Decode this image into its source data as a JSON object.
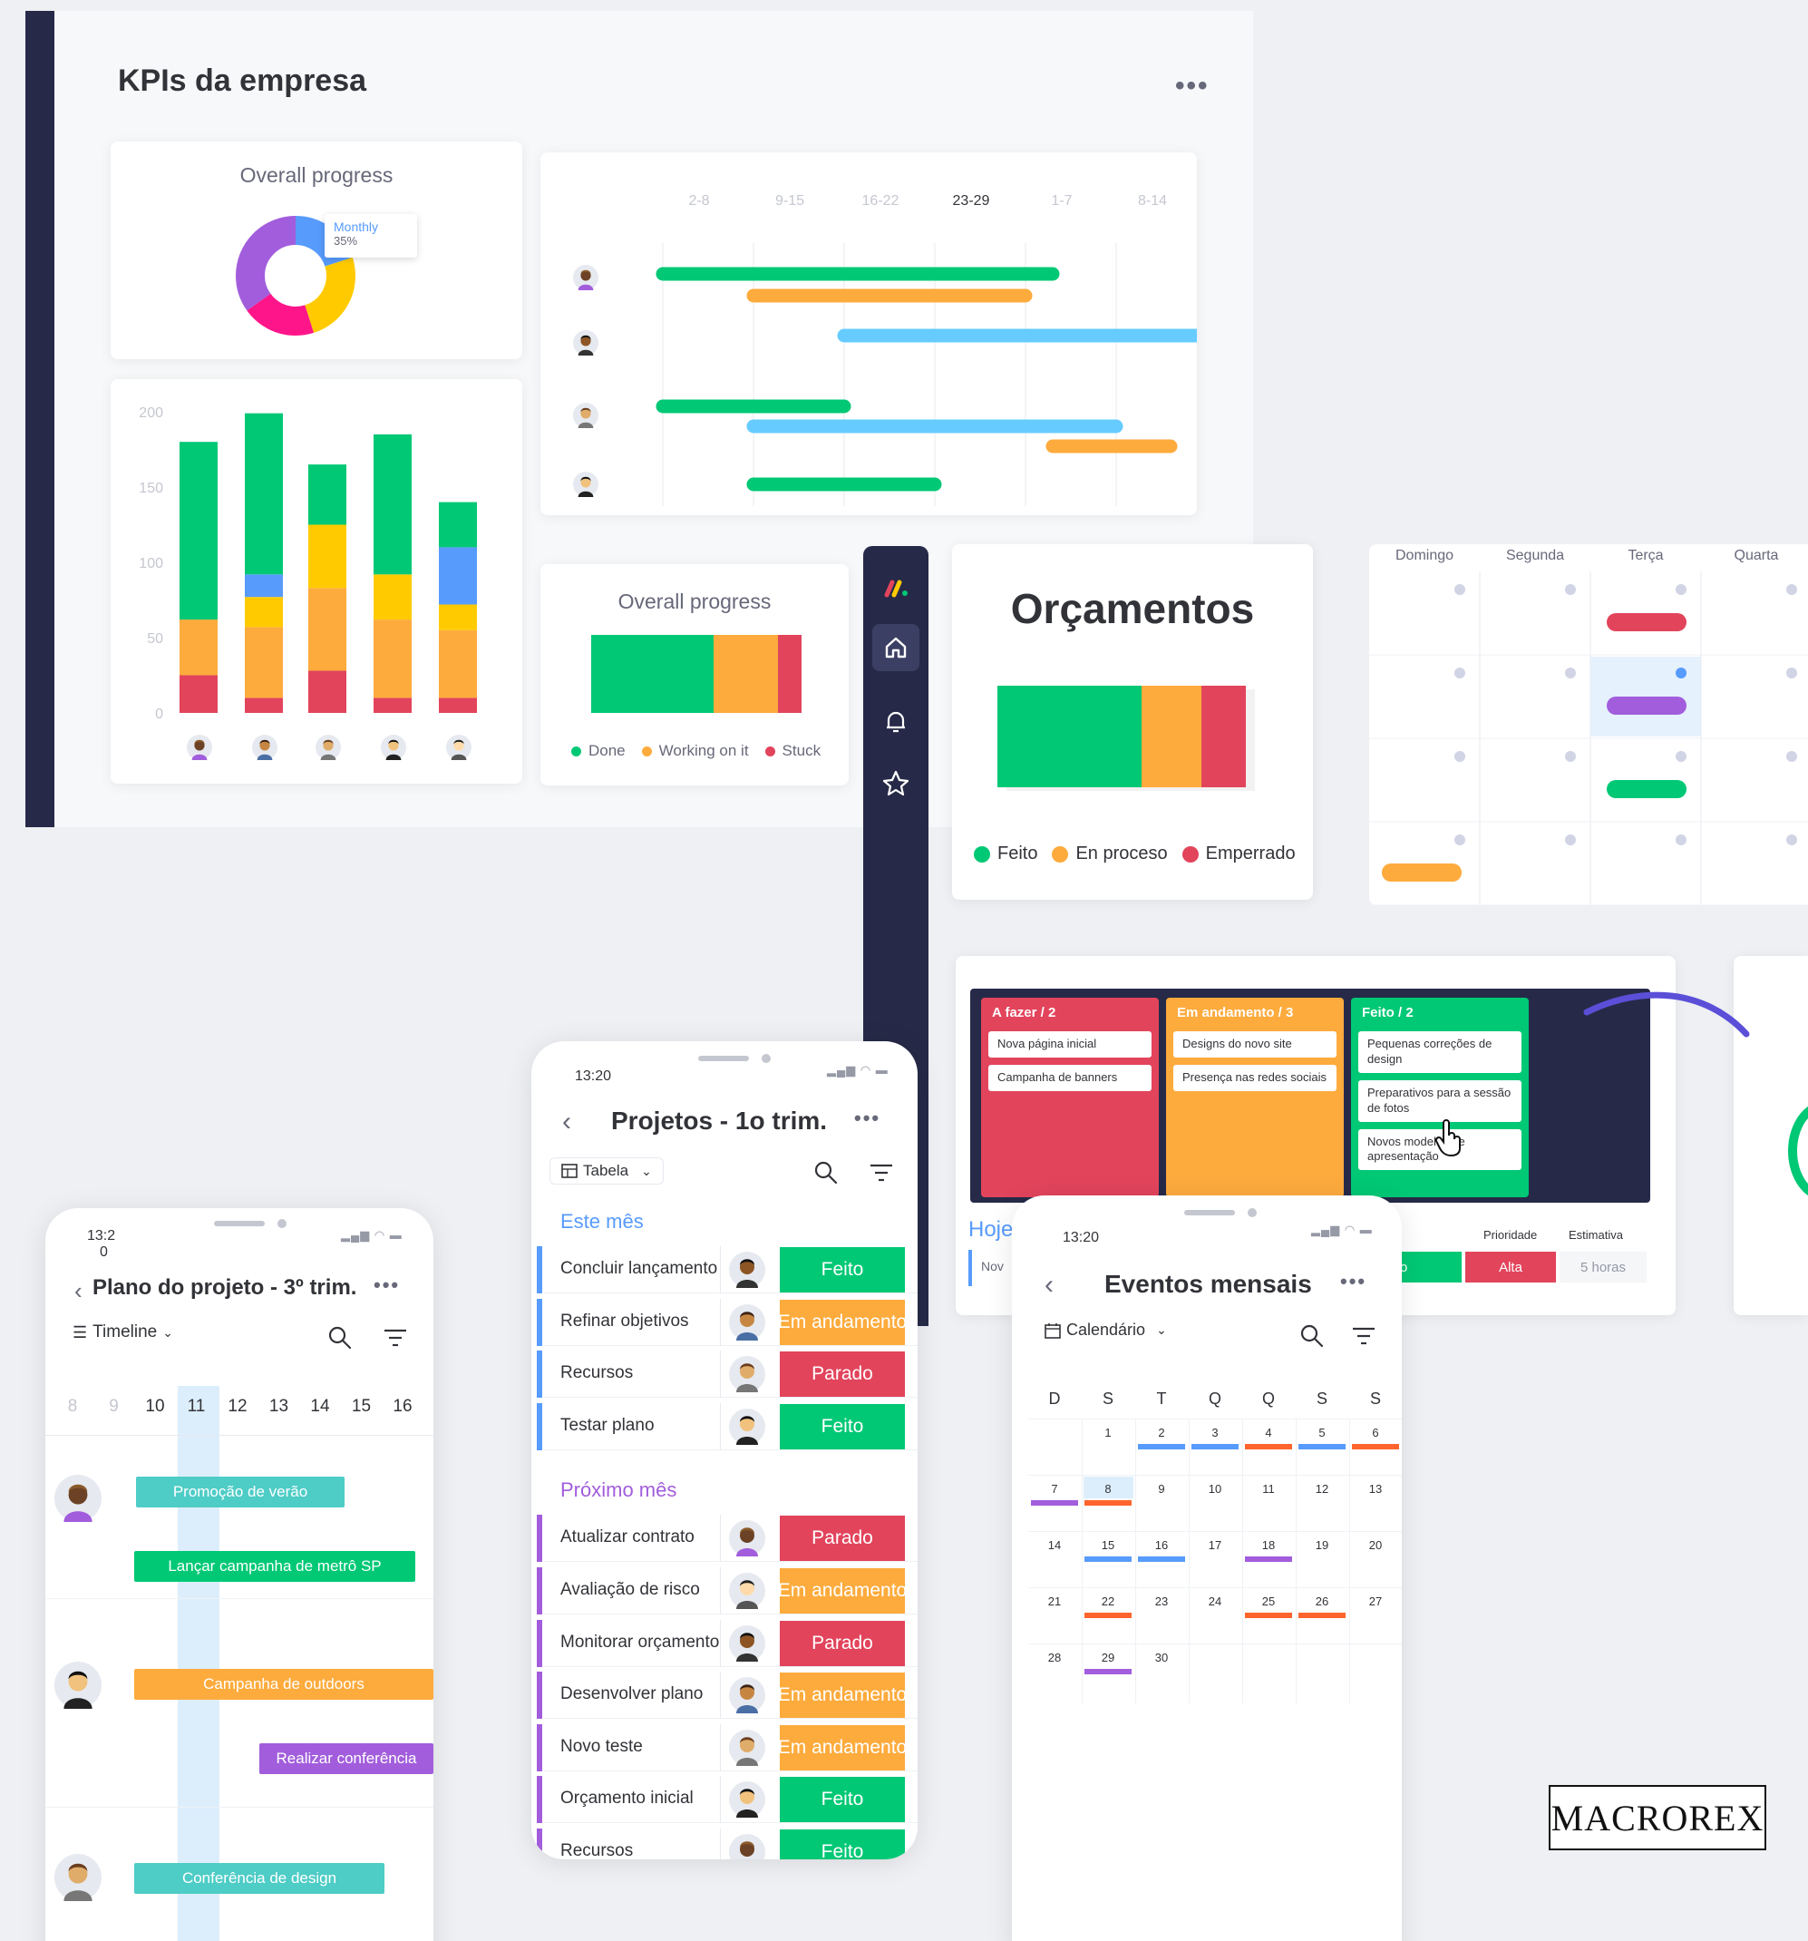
{
  "colors": {
    "done": "#00c875",
    "working": "#fdab3d",
    "stuck": "#e2445c",
    "blue": "#579bfc",
    "light_blue": "#66ccff",
    "purple": "#a25ddc",
    "teal": "#4eccc6",
    "yellow": "#ffcb00",
    "pink": "#ff158a",
    "navy": "#262a48"
  },
  "dashboard": {
    "title": "KPIs da empresa",
    "menu": "•••",
    "overall_progress_title": "Overall progress",
    "donut_tooltip": {
      "label": "Monthly",
      "value": "35%"
    },
    "donut_segments": [
      {
        "color": "#579bfc",
        "value": 20
      },
      {
        "color": "#ffcb00",
        "value": 25
      },
      {
        "color": "#ff158a",
        "value": 20
      },
      {
        "color": "#a25ddc",
        "value": 35
      }
    ],
    "bar_chart": {
      "y_ticks": [
        "200",
        "150",
        "100",
        "50",
        "0"
      ],
      "ylim": [
        0,
        200
      ],
      "columns": [
        [
          {
            "c": "#e2445c",
            "v": 25
          },
          {
            "c": "#fdab3d",
            "v": 37
          },
          {
            "c": "#00c875",
            "v": 118
          }
        ],
        [
          {
            "c": "#e2445c",
            "v": 10
          },
          {
            "c": "#fdab3d",
            "v": 47
          },
          {
            "c": "#ffcb00",
            "v": 20
          },
          {
            "c": "#579bfc",
            "v": 15
          },
          {
            "c": "#00c875",
            "v": 107
          }
        ],
        [
          {
            "c": "#e2445c",
            "v": 28
          },
          {
            "c": "#fdab3d",
            "v": 55
          },
          {
            "c": "#ffcb00",
            "v": 42
          },
          {
            "c": "#00c875",
            "v": 40
          }
        ],
        [
          {
            "c": "#e2445c",
            "v": 10
          },
          {
            "c": "#fdab3d",
            "v": 52
          },
          {
            "c": "#ffcb00",
            "v": 30
          },
          {
            "c": "#00c875",
            "v": 93
          }
        ],
        [
          {
            "c": "#e2445c",
            "v": 10
          },
          {
            "c": "#fdab3d",
            "v": 45
          },
          {
            "c": "#ffcb00",
            "v": 17
          },
          {
            "c": "#579bfc",
            "v": 38
          },
          {
            "c": "#00c875",
            "v": 30
          }
        ]
      ]
    },
    "gantt": {
      "weeks": [
        "2-8",
        "9-15",
        "16-22",
        "23-29",
        "1-7",
        "8-14"
      ],
      "active_week": "23-29",
      "rows": [
        [
          {
            "c": "#00c875",
            "start": 0,
            "end": 4.3
          },
          {
            "c": "#fdab3d",
            "start": 1.0,
            "end": 4.0
          }
        ],
        [
          {
            "c": "#66ccff",
            "start": 2.0,
            "end": 5.9
          }
        ],
        [
          {
            "c": "#00c875",
            "start": 0,
            "end": 2.0
          },
          {
            "c": "#66ccff",
            "start": 1.0,
            "end": 5.0
          },
          {
            "c": "#fdab3d",
            "start": 4.3,
            "end": 5.6
          }
        ],
        [
          {
            "c": "#00c875",
            "start": 1.0,
            "end": 3.0
          }
        ]
      ]
    },
    "progress_bar": {
      "title": "Overall progress",
      "parts": [
        {
          "c": "#00c875",
          "v": 58
        },
        {
          "c": "#fdab3d",
          "v": 31
        },
        {
          "c": "#e2445c",
          "v": 11
        }
      ],
      "legend": [
        {
          "label": "Done",
          "c": "#00c875"
        },
        {
          "label": "Working on it",
          "c": "#fdab3d"
        },
        {
          "label": "Stuck",
          "c": "#e2445c"
        }
      ]
    }
  },
  "budget": {
    "title": "Orçamentos",
    "parts": [
      {
        "c": "#00c875",
        "v": 58
      },
      {
        "c": "#fdab3d",
        "v": 24
      },
      {
        "c": "#e2445c",
        "v": 18
      }
    ],
    "legend": [
      {
        "label": "Feito",
        "c": "#00c875"
      },
      {
        "label": "En proceso",
        "c": "#fdab3d"
      },
      {
        "label": "Emperrado",
        "c": "#e2445c"
      }
    ]
  },
  "week_calendar": {
    "days": [
      "Domingo",
      "Segunda",
      "Terça",
      "Quarta"
    ]
  },
  "kanban": {
    "columns": [
      {
        "title": "A fazer / 2",
        "color": "#e2445c",
        "cards": [
          "Nova página inicial",
          "Campanha de banners"
        ]
      },
      {
        "title": "Em andamento / 3",
        "color": "#fdab3d",
        "cards": [
          "Designs do novo site",
          "Presença nas redes sociais"
        ]
      },
      {
        "title": "Feito / 2",
        "color": "#00c875",
        "cards": [
          "Pequenas correções de design",
          "Preparativos para a sessão de fotos",
          "Novos modelos de apresentação"
        ]
      }
    ],
    "today_label": "Hoje",
    "today_item": "Nov",
    "col_priority": "Prioridade",
    "col_estimate": "Estimativa",
    "priority_value": "Alta",
    "estimate_value": "5 horas",
    "status_value": "o"
  },
  "phone_projects": {
    "time": "13:20",
    "title": "Projetos - 1o trim.",
    "menu": "•••",
    "view": "Tabela",
    "groups": [
      {
        "title": "Este mês",
        "color": "#579bfc",
        "rows": [
          {
            "name": "Concluir lançamento",
            "status": "Feito",
            "c": "#00c875"
          },
          {
            "name": "Refinar objetivos",
            "status": "Em andamento",
            "c": "#fdab3d"
          },
          {
            "name": "Recursos",
            "status": "Parado",
            "c": "#e2445c"
          },
          {
            "name": "Testar plano",
            "status": "Feito",
            "c": "#00c875"
          }
        ]
      },
      {
        "title": "Próximo mês",
        "color": "#a25ddc",
        "rows": [
          {
            "name": "Atualizar contrato",
            "status": "Parado",
            "c": "#e2445c"
          },
          {
            "name": "Avaliação de risco",
            "status": "Em andamento",
            "c": "#fdab3d"
          },
          {
            "name": "Monitorar orçamento",
            "status": "Parado",
            "c": "#e2445c"
          },
          {
            "name": "Desenvolver plano",
            "status": "Em andamento",
            "c": "#fdab3d"
          },
          {
            "name": "Novo teste",
            "status": "Em andamento",
            "c": "#fdab3d"
          },
          {
            "name": "Orçamento inicial",
            "status": "Feito",
            "c": "#00c875"
          },
          {
            "name": "Recursos",
            "status": "Feito",
            "c": "#00c875"
          }
        ]
      }
    ]
  },
  "phone_timeline": {
    "time_line1": "13:2",
    "time_line2": "0",
    "title": "Plano do projeto - 3º trim.",
    "menu": "•••",
    "view": "Timeline",
    "days": [
      "8",
      "9",
      "10",
      "11",
      "12",
      "13",
      "14",
      "15",
      "16"
    ],
    "today": "11",
    "bars": [
      {
        "label": "Promoção de verão",
        "c": "#4eccc6"
      },
      {
        "label": "Lançar campanha de metrô SP",
        "c": "#00c875"
      },
      {
        "label": "Campanha de outdoors",
        "c": "#fdab3d"
      },
      {
        "label": "Realizar conferência",
        "c": "#a25ddc"
      },
      {
        "label": "Conferência de design",
        "c": "#4eccc6"
      }
    ]
  },
  "phone_events": {
    "time": "13:20",
    "title": "Eventos mensais",
    "menu": "•••",
    "view": "Calendário",
    "weekdays": [
      "D",
      "S",
      "T",
      "Q",
      "Q",
      "S",
      "S"
    ],
    "weeks": [
      [
        "",
        "1",
        "2",
        "3",
        "4",
        "5",
        "6"
      ],
      [
        "7",
        "8",
        "9",
        "10",
        "11",
        "12",
        "13"
      ],
      [
        "14",
        "15",
        "16",
        "17",
        "18",
        "19",
        "20"
      ],
      [
        "21",
        "22",
        "23",
        "24",
        "25",
        "26",
        "27"
      ],
      [
        "28",
        "29",
        "30",
        "",
        "",
        "",
        ""
      ]
    ],
    "today": "8"
  },
  "brand": {
    "logo_text": "MACROREX"
  }
}
